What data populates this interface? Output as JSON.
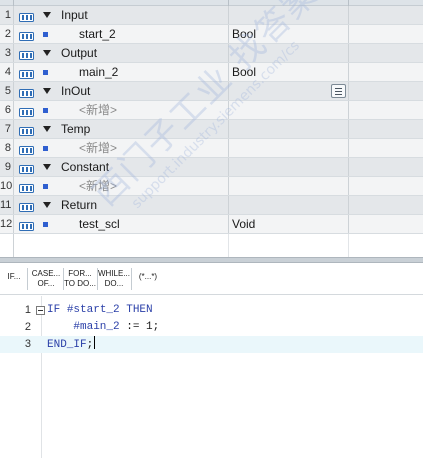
{
  "interface": {
    "rows": [
      {
        "num": "1",
        "kind": "section",
        "name": "Input",
        "datatype": ""
      },
      {
        "num": "2",
        "kind": "item",
        "name": "start_2",
        "datatype": "Bool"
      },
      {
        "num": "3",
        "kind": "section",
        "name": "Output",
        "datatype": ""
      },
      {
        "num": "4",
        "kind": "item",
        "name": "main_2",
        "datatype": "Bool"
      },
      {
        "num": "5",
        "kind": "section",
        "name": "InOut",
        "datatype": ""
      },
      {
        "num": "6",
        "kind": "add",
        "name": "<新增>",
        "datatype": ""
      },
      {
        "num": "7",
        "kind": "section",
        "name": "Temp",
        "datatype": ""
      },
      {
        "num": "8",
        "kind": "add",
        "name": "<新增>",
        "datatype": ""
      },
      {
        "num": "9",
        "kind": "section",
        "name": "Constant",
        "datatype": ""
      },
      {
        "num": "10",
        "kind": "add",
        "name": "<新增>",
        "datatype": ""
      },
      {
        "num": "11",
        "kind": "section",
        "name": "Return",
        "datatype": ""
      },
      {
        "num": "12",
        "kind": "item",
        "name": "test_scl",
        "datatype": "Void"
      }
    ]
  },
  "toolbar": {
    "if_label": "IF...",
    "case_label": "CASE...\nOF...",
    "for_label": "FOR...\nTO DO...",
    "while_label": "WHILE...\nDO...",
    "comment_label": "(*...*)"
  },
  "editor": {
    "lines": [
      {
        "num": "1",
        "tokens": [
          {
            "t": "IF ",
            "c": "kw"
          },
          {
            "t": "#start_2",
            "c": "var"
          },
          {
            "t": " THEN",
            "c": "kw"
          }
        ]
      },
      {
        "num": "2",
        "tokens": [
          {
            "t": "    #main_2",
            "c": "var"
          },
          {
            "t": " := ",
            "c": "op"
          },
          {
            "t": "1",
            "c": "op"
          },
          {
            "t": ";",
            "c": "op"
          }
        ]
      },
      {
        "num": "3",
        "tokens": [
          {
            "t": "END_IF",
            "c": "kw"
          },
          {
            "t": ";",
            "c": "op"
          }
        ]
      }
    ]
  },
  "watermark": {
    "text": "西门子工业 找答案",
    "url": "support.industry.siemens.com/cs"
  },
  "colors": {
    "section_bg": "#e4e7ea",
    "item_bg": "#f3f4f5",
    "keyword": "#2a3fa8",
    "current_line": "#eaf7fb"
  }
}
